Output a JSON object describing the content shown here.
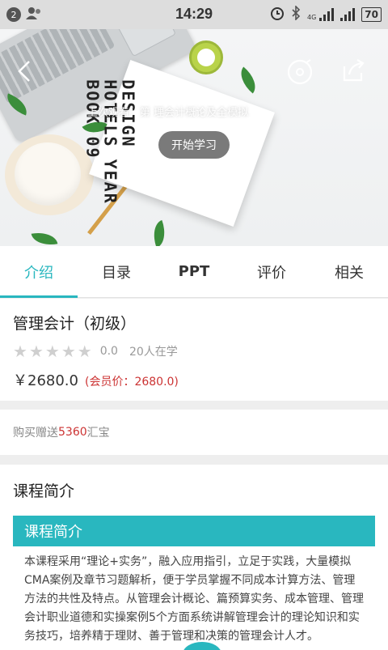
{
  "status_bar": {
    "notification_count": "2",
    "time": "14:29",
    "network": "4G",
    "battery": "70"
  },
  "hero": {
    "overlay_text": "上次观看：第    理会计概论及全模拟",
    "start_button": "开始学习",
    "book_text": "DESIGN HOTELS YEAR BOOK 09"
  },
  "tabs": [
    {
      "label": "介绍"
    },
    {
      "label": "目录"
    },
    {
      "label": "PPT"
    },
    {
      "label": "评价"
    },
    {
      "label": "相关"
    }
  ],
  "course": {
    "title": "管理会计（初级）",
    "rating_score": "0.0",
    "rating_stars": 0,
    "learners": "20人在学",
    "price": "￥2680.0",
    "member_price": "(会员价：2680.0)"
  },
  "gift": {
    "prefix": "购买赠送",
    "amount": "5360",
    "suffix": "汇宝"
  },
  "intro": {
    "heading": "课程简介",
    "banner": "课程简介",
    "body": "本课程采用“理论+实务”，融入应用指引，立足于实践，大量模拟CMA案例及章节习题解析，便于学员掌握不同成本计算方法、管理方法的共性及特点。从管理会计概论、篇预算实务、成本管理、管理会计职业道德和实操案例5个方面系统讲解管理会计的理论知识和实务技巧，培养精于理财、善于管理和决策的管理会计人才。"
  },
  "colors": {
    "accent": "#29b7bf",
    "price_red": "#cc3333"
  }
}
